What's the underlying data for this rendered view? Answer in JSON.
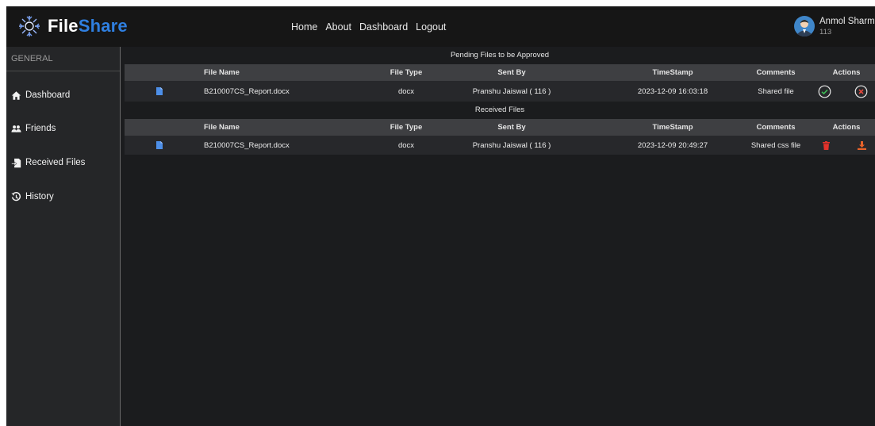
{
  "app": {
    "brand_part1": "File",
    "brand_part2": "Share",
    "brand_color": "#2f7fe0"
  },
  "nav": {
    "links": [
      "Home",
      "About",
      "Dashboard",
      "Logout"
    ]
  },
  "user": {
    "name": "Anmol Sharma",
    "id": "113"
  },
  "sidebar": {
    "heading": "GENERAL",
    "items": [
      {
        "label": "Dashboard",
        "icon": "home-icon"
      },
      {
        "label": "Friends",
        "icon": "users-icon"
      },
      {
        "label": "Received Files",
        "icon": "received-files-icon"
      },
      {
        "label": "History",
        "icon": "history-icon"
      }
    ]
  },
  "pending": {
    "title": "Pending Files to be Approved",
    "columns": [
      "File Name",
      "File Type",
      "Sent By",
      "TimeStamp",
      "Comments",
      "Actions"
    ],
    "rows": [
      {
        "file_name": "B210007CS_Report.docx",
        "file_type": "docx",
        "sent_by": "Pranshu Jaiswal ( 116 )",
        "timestamp": "2023-12-09 16:03:18",
        "comments": "Shared file",
        "actions": [
          "approve-icon",
          "reject-icon"
        ]
      }
    ]
  },
  "received": {
    "title": "Received Files",
    "columns": [
      "File Name",
      "File Type",
      "Sent By",
      "TimeStamp",
      "Comments",
      "Actions"
    ],
    "rows": [
      {
        "file_name": "B210007CS_Report.docx",
        "file_type": "docx",
        "sent_by": "Pranshu Jaiswal ( 116 )",
        "timestamp": "2023-12-09 20:49:27",
        "comments": "Shared css file",
        "actions": [
          "delete-icon",
          "download-icon"
        ]
      }
    ]
  },
  "colors": {
    "approve": "#3dbb55",
    "reject": "#e0483d",
    "delete": "#e3322b",
    "download": "#e8632a",
    "file_icon": "#4d8fe8"
  }
}
